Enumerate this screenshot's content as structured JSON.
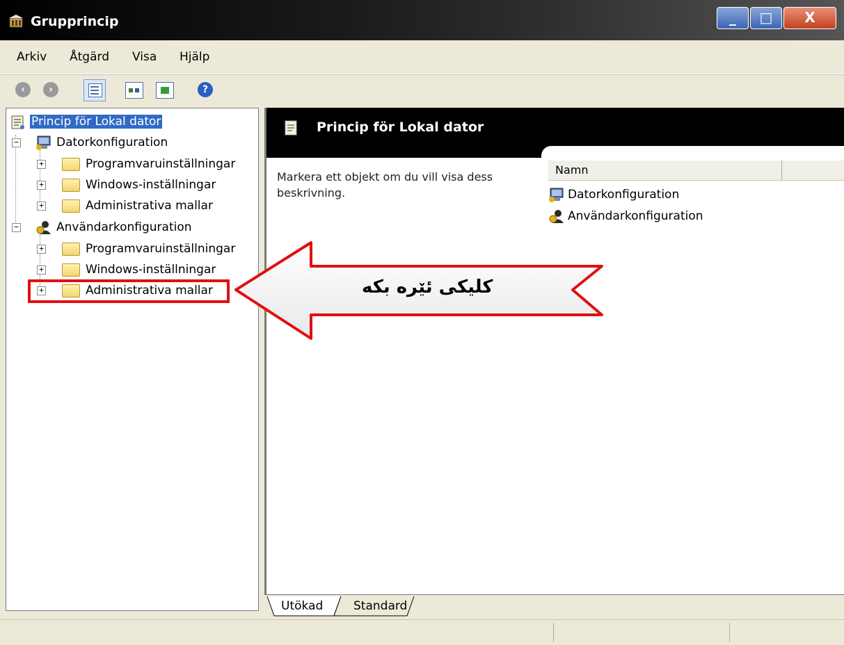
{
  "window": {
    "title": "Grupprincip",
    "icon": "group-policy-icon"
  },
  "menu": [
    "Arkiv",
    "Åtgärd",
    "Visa",
    "Hjälp"
  ],
  "toolbar": {
    "icons": [
      "back-icon",
      "forward-icon",
      "show-hide-tree-icon",
      "properties-icon",
      "export-list-icon",
      "help-icon"
    ],
    "help_glyph": "?"
  },
  "tree": {
    "root": "Princip för Lokal dator",
    "computer": "Datorkonfiguration",
    "computer_children": [
      "Programvaruinställningar",
      "Windows-inställningar",
      "Administrativa mallar"
    ],
    "user": "Användarkonfiguration",
    "user_children": [
      "Programvaruinställningar",
      "Windows-inställningar",
      "Administrativa mallar"
    ]
  },
  "right_pane": {
    "header_title": "Princip för Lokal dator",
    "description": "Markera ett objekt om du vill visa dess beskrivning.",
    "column_name": "Namn",
    "items": [
      "Datorkonfiguration",
      "Användarkonfiguration"
    ]
  },
  "tabs": [
    "Utökad",
    "Standard"
  ],
  "annotation": {
    "text": "کلیکی ئێره بکه",
    "color": "#e01010"
  }
}
